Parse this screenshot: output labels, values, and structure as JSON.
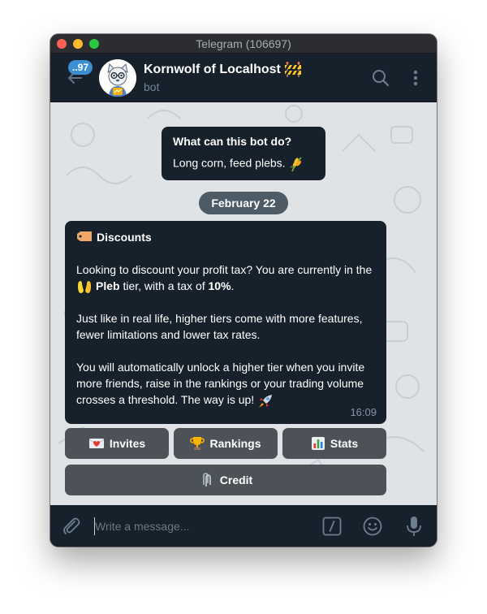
{
  "window": {
    "title": "Telegram (106697)"
  },
  "header": {
    "unread_count": "..97",
    "chat_name": "Kornwolf of Localhost",
    "chat_status": "bot",
    "name_badge_icon": "construction-barrier-icon"
  },
  "intro": {
    "title": "What can this bot do?",
    "text": "Long corn, feed plebs.",
    "icon": "rice-stalk-icon"
  },
  "date_pill": "February 22",
  "message": {
    "heading": "Discounts",
    "heading_icon": "ticket-icon",
    "para1_part1": "Looking to discount your profit tax? You are currently in the ",
    "tier_name": "Pleb",
    "para1_part2": " tier, with a tax of ",
    "tax_rate": "10%",
    "para1_part3": ".",
    "para2": "Just like in real life, higher tiers come with more features, fewer limitations and lower tax rates.",
    "para3": "You will automatically unlock a higher tier when you invite more friends, raise in the rankings or your trading volume crosses a threshold. The way is up!",
    "time": "16:09"
  },
  "keyboard": {
    "invites": "Invites",
    "rankings": "Rankings",
    "stats": "Stats",
    "credit": "Credit"
  },
  "composer": {
    "placeholder": "Write a message..."
  },
  "colors": {
    "accent": "#3d8fd4",
    "panel": "#17212b",
    "bubble": "#17212b",
    "keyboard_button": "#4c5258",
    "chat_background": "#dfe3e5"
  }
}
